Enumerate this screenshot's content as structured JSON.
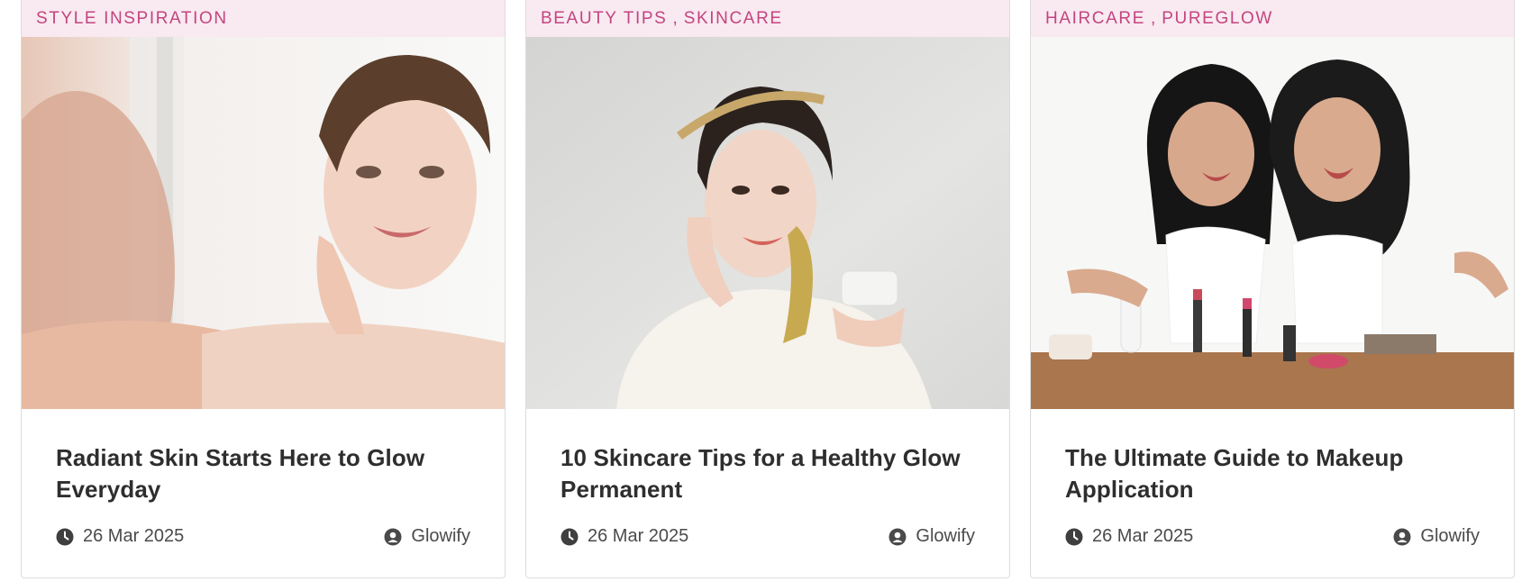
{
  "colors": {
    "category_bg": "#f9e9f1",
    "category_text": "#c2457f",
    "title_text": "#2e2e2e",
    "meta_text": "#4a4a4a"
  },
  "cards": [
    {
      "categories": [
        "STYLE INSPIRATION"
      ],
      "image_alt": "Woman touching her cheek in front of a mirror",
      "title": "Radiant Skin Starts Here to Glow Everyday",
      "date": "26 Mar 2025",
      "author": "Glowify"
    },
    {
      "categories": [
        "BEAUTY TIPS",
        "SKINCARE"
      ],
      "image_alt": "Woman applying cream to her face holding a jar",
      "title": "10 Skincare Tips for a Healthy Glow Permanent",
      "date": "26 Mar 2025",
      "author": "Glowify"
    },
    {
      "categories": [
        "HAIRCARE",
        "PUREGLOW"
      ],
      "image_alt": "Two women laughing behind a table of makeup products",
      "title": "The Ultimate Guide to Makeup Application",
      "date": "26 Mar 2025",
      "author": "Glowify"
    }
  ],
  "icons": {
    "date": "clock-icon",
    "author": "user-circle-icon"
  }
}
